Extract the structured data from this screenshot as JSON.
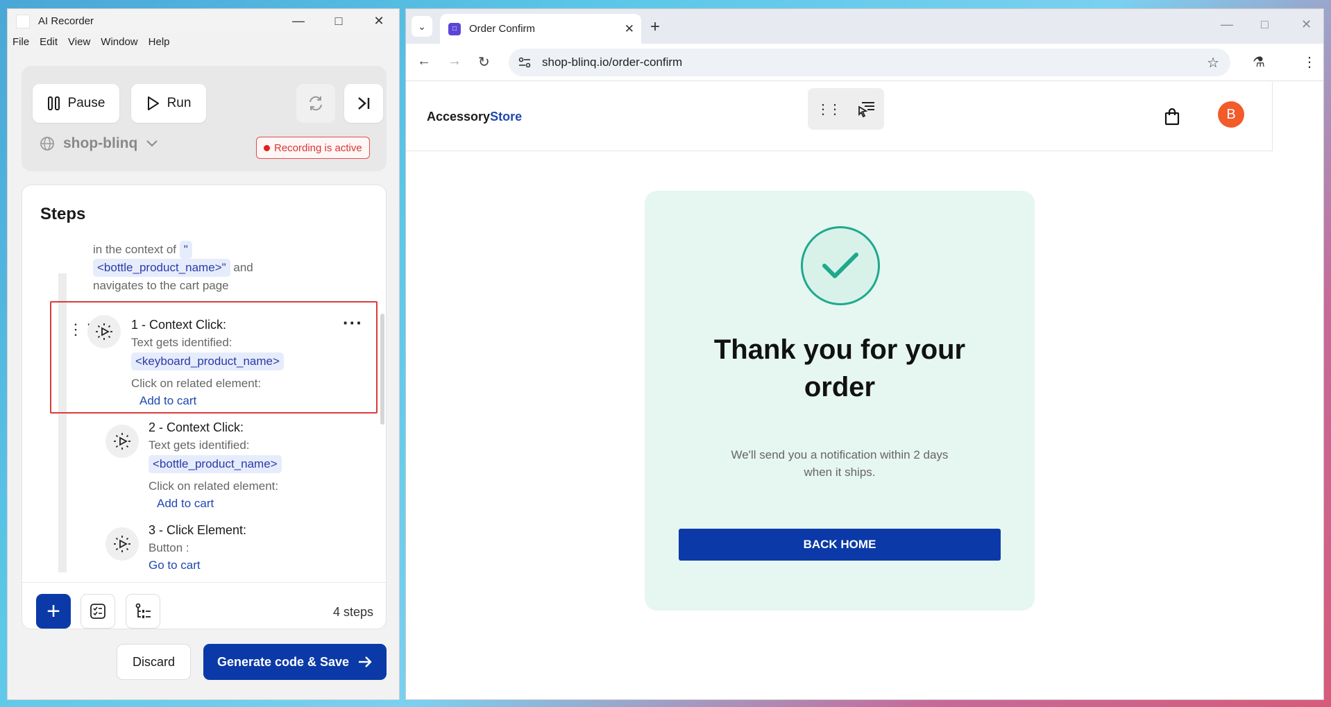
{
  "recorder": {
    "window_title": "AI Recorder",
    "menu": [
      "File",
      "Edit",
      "View",
      "Window",
      "Help"
    ],
    "pause_label": "Pause",
    "run_label": "Run",
    "site_name": "shop-blinq",
    "recording_status": "Recording is active",
    "steps_title": "Steps",
    "context_text": {
      "prefix": "in the context of",
      "open_quote": "\"",
      "tag": "<bottle_product_name>\"",
      "suffix": "and navigates to the cart page"
    },
    "steps": [
      {
        "heading": "1 - Context Click:",
        "line1": "Text gets identified:",
        "tag": "<keyboard_product_name>",
        "line2": "Click on related element:",
        "link": "Add to cart"
      },
      {
        "heading": "2 - Context Click:",
        "line1": "Text gets identified:",
        "tag": "<bottle_product_name>",
        "line2": "Click on related element:",
        "link": "Add to cart"
      },
      {
        "heading": "3 - Click Element:",
        "line1": "Button :",
        "link": "Go to cart"
      }
    ],
    "steps_count": "4 steps",
    "discard_label": "Discard",
    "generate_label": "Generate code & Save"
  },
  "browser": {
    "tab_title": "Order Confirm",
    "url": "shop-blinq.io/order-confirm"
  },
  "store": {
    "logo_part1": "Accessory",
    "logo_part2": "Store",
    "avatar_letter": "B",
    "thanks_heading": "Thank you for your order",
    "notification": "We'll send you a notification within 2 days when it ships.",
    "back_home_label": "BACK HOME"
  },
  "colors": {
    "primary": "#0b3aa8",
    "recording_red": "#dc3a3a",
    "success_teal": "#1fa88c",
    "card_bg": "#e6f6f1",
    "avatar_orange": "#f25b2a"
  }
}
